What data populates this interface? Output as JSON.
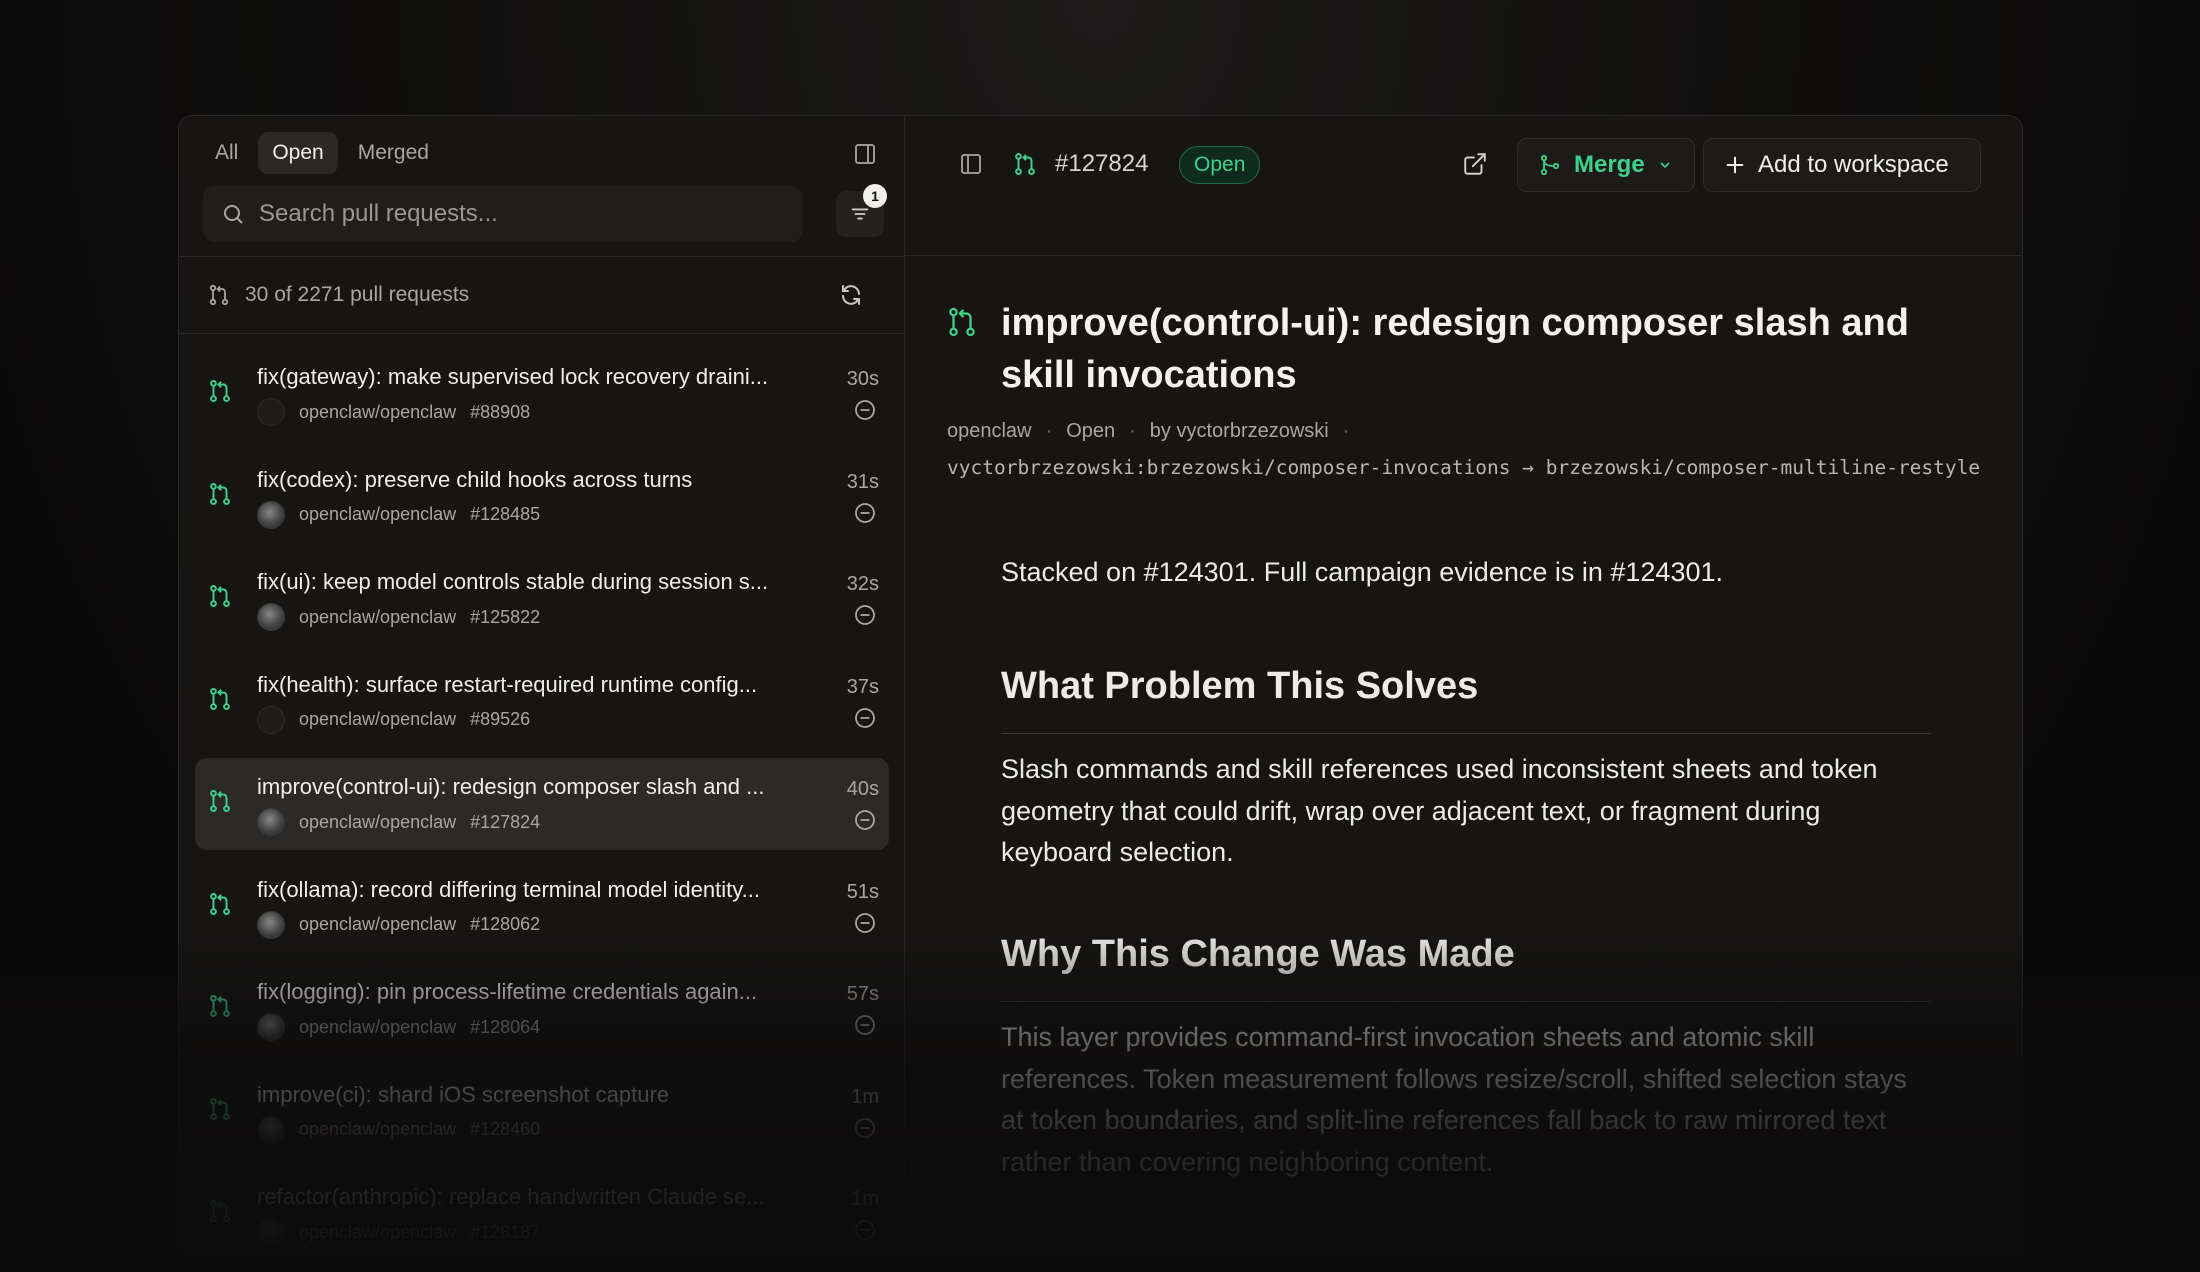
{
  "sidebar": {
    "tabs": [
      {
        "label": "All",
        "active": false
      },
      {
        "label": "Open",
        "active": true
      },
      {
        "label": "Merged",
        "active": false
      }
    ],
    "search_placeholder": "Search pull requests...",
    "filter_count": "1",
    "count_text": "30 of 2271 pull requests",
    "items": [
      {
        "title": "fix(gateway): make supervised lock recovery draini...",
        "repo": "openclaw/openclaw",
        "number": "#88908",
        "time": "30s",
        "avatar": "blank",
        "selected": false
      },
      {
        "title": "fix(codex): preserve child hooks across turns",
        "repo": "openclaw/openclaw",
        "number": "#128485",
        "time": "31s",
        "avatar": "photo",
        "selected": false
      },
      {
        "title": "fix(ui): keep model controls stable during session s...",
        "repo": "openclaw/openclaw",
        "number": "#125822",
        "time": "32s",
        "avatar": "photo",
        "selected": false
      },
      {
        "title": "fix(health): surface restart-required runtime config...",
        "repo": "openclaw/openclaw",
        "number": "#89526",
        "time": "37s",
        "avatar": "blank",
        "selected": false
      },
      {
        "title": "improve(control-ui): redesign composer slash and ...",
        "repo": "openclaw/openclaw",
        "number": "#127824",
        "time": "40s",
        "avatar": "photo",
        "selected": true
      },
      {
        "title": "fix(ollama): record differing terminal model identity...",
        "repo": "openclaw/openclaw",
        "number": "#128062",
        "time": "51s",
        "avatar": "photo",
        "selected": false
      },
      {
        "title": "fix(logging): pin process-lifetime credentials again...",
        "repo": "openclaw/openclaw",
        "number": "#128064",
        "time": "57s",
        "avatar": "photo",
        "selected": false
      },
      {
        "title": "improve(ci): shard iOS screenshot capture",
        "repo": "openclaw/openclaw",
        "number": "#128460",
        "time": "1m",
        "avatar": "photo",
        "selected": false
      },
      {
        "title": "refactor(anthropic): replace handwritten Claude se...",
        "repo": "openclaw/openclaw",
        "number": "#128187",
        "time": "1m",
        "avatar": "photo",
        "selected": false
      }
    ]
  },
  "header": {
    "pr_number": "#127824",
    "status": "Open",
    "merge_label": "Merge",
    "workspace_label": "Add to workspace"
  },
  "detail": {
    "title": "improve(control-ui): redesign composer slash and skill invocations",
    "meta": {
      "repo": "openclaw",
      "status": "Open",
      "author": "by vyctorbrzezowski"
    },
    "branch": "vyctorbrzezowski:brzezowski/composer-invocations → brzezowski/composer-multiline-restyle",
    "body": {
      "stacked": "Stacked on #124301. Full campaign evidence is in #124301.",
      "h_problem": "What Problem This Solves",
      "p_problem": "Slash commands and skill references used inconsistent sheets and token geometry that could drift, wrap over adjacent text, or fragment during keyboard selection.",
      "h_why": "Why This Change Was Made",
      "p_why": "This layer provides command-first invocation sheets and atomic skill references. Token measurement follows resize/scroll, shifted selection stays at token boundaries, and split-line references fall back to raw mirrored text rather than covering neighboring content."
    }
  },
  "colors": {
    "accent_green": "#3ed18a",
    "background": "#161514"
  }
}
